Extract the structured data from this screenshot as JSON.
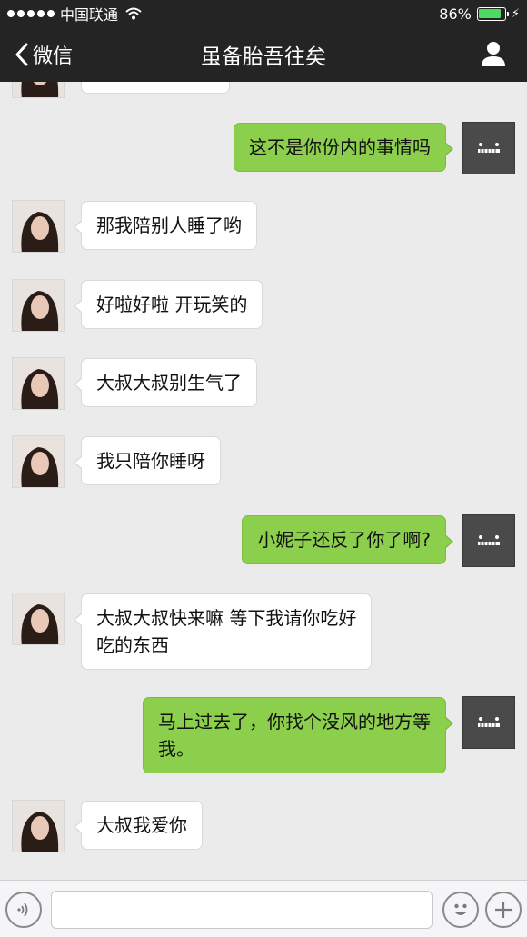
{
  "status_bar": {
    "carrier": "中国联通",
    "battery_text": "86%",
    "battery_level": 0.86
  },
  "nav": {
    "back_label": "微信",
    "title": "虽备胎吾往矣",
    "profile_icon": "person-icon"
  },
  "messages": [
    {
      "side": "in",
      "text": ""
    },
    {
      "side": "out",
      "text": "这不是你份内的事情吗"
    },
    {
      "side": "in",
      "text": "那我陪别人睡了哟"
    },
    {
      "side": "in",
      "text": "好啦好啦 开玩笑的"
    },
    {
      "side": "in",
      "text": "大叔大叔别生气了"
    },
    {
      "side": "in",
      "text": "我只陪你睡呀"
    },
    {
      "side": "out",
      "text": "小妮子还反了你了啊?"
    },
    {
      "side": "in",
      "text": "大叔大叔快来嘛 等下我请你吃好\n吃的东西"
    },
    {
      "side": "out",
      "text": "马上过去了，你找个没风的地方等\n我。"
    },
    {
      "side": "in",
      "text": "大叔我爱你"
    }
  ],
  "input_bar": {
    "voice_icon": "voice-icon",
    "emoji_icon": "emoji-icon",
    "plus_icon": "plus-icon",
    "placeholder": ""
  },
  "colors": {
    "nav_bg": "#242424",
    "chat_bg": "#ebebeb",
    "outgoing_bubble": "#8ccf4c",
    "incoming_bubble": "#ffffff",
    "battery": "#4cd964"
  }
}
